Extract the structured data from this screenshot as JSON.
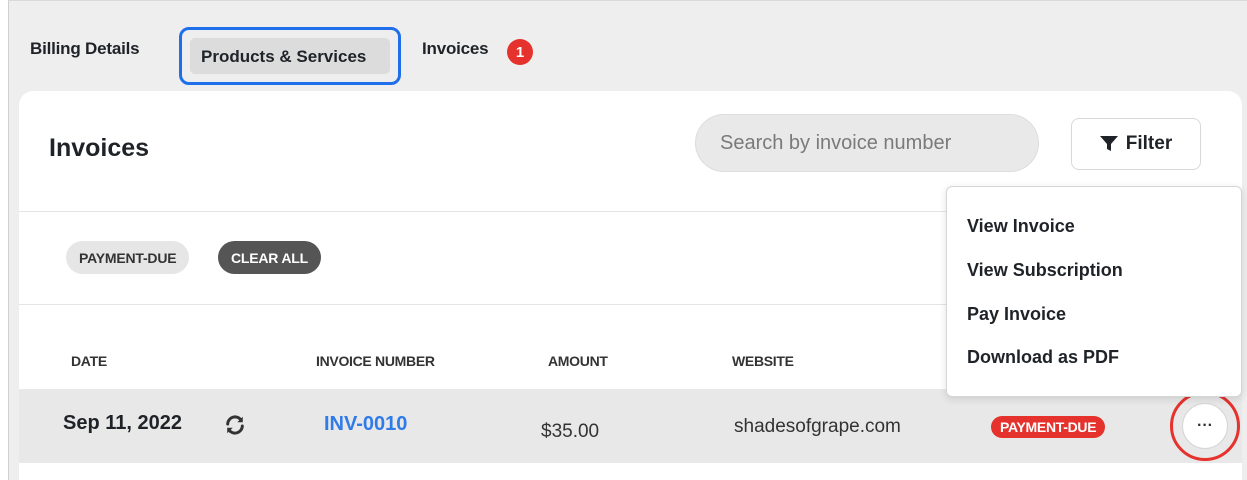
{
  "tabs": {
    "billing": "Billing Details",
    "products": "Products & Services",
    "invoices": "Invoices",
    "invoices_badge": "1"
  },
  "card": {
    "title": "Invoices",
    "search_placeholder": "Search by invoice number",
    "filter_label": "Filter",
    "filter_icon": "funnel-icon"
  },
  "active_filters": {
    "chip": "PAYMENT-DUE",
    "clear_label": "CLEAR ALL"
  },
  "table": {
    "headers": {
      "date": "DATE",
      "invoice_number": "INVOICE NUMBER",
      "amount": "AMOUNT",
      "website": "WEBSITE"
    },
    "rows": [
      {
        "date": "Sep 11, 2022",
        "recurring_icon": "refresh-icon",
        "invoice_number": "INV-0010",
        "amount": "$35.00",
        "website": "shadesofgrape.com",
        "status": "PAYMENT-DUE",
        "more_label": "···"
      }
    ]
  },
  "menu": {
    "items": [
      "View Invoice",
      "View Subscription",
      "Pay Invoice",
      "Download as PDF"
    ]
  },
  "colors": {
    "accent_blue": "#1f6feb",
    "link_blue": "#2f7be8",
    "status_red": "#e5322d",
    "chip_dark": "#555555"
  }
}
